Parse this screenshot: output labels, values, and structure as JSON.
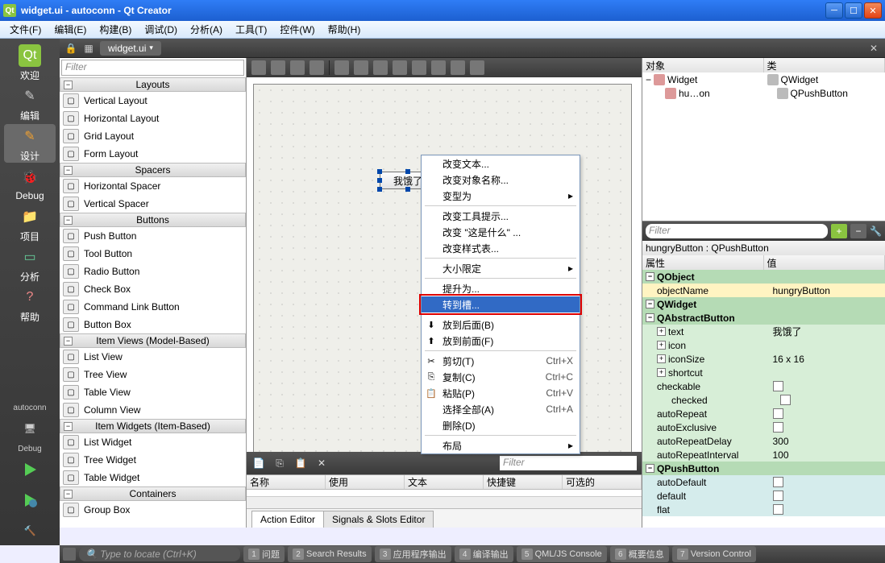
{
  "title": "widget.ui - autoconn - Qt Creator",
  "menu": [
    "文件(F)",
    "编辑(E)",
    "构建(B)",
    "调试(D)",
    "分析(A)",
    "工具(T)",
    "控件(W)",
    "帮助(H)"
  ],
  "leftbar": {
    "items": [
      "欢迎",
      "编辑",
      "设计",
      "Debug",
      "项目",
      "分析",
      "帮助"
    ],
    "project": "autoconn",
    "debug": "Debug"
  },
  "doctab": "widget.ui",
  "wbx": {
    "filter": "Filter",
    "cats": [
      {
        "name": "Layouts",
        "items": [
          "Vertical Layout",
          "Horizontal Layout",
          "Grid Layout",
          "Form Layout"
        ]
      },
      {
        "name": "Spacers",
        "items": [
          "Horizontal Spacer",
          "Vertical Spacer"
        ]
      },
      {
        "name": "Buttons",
        "items": [
          "Push Button",
          "Tool Button",
          "Radio Button",
          "Check Box",
          "Command Link Button",
          "Button Box"
        ]
      },
      {
        "name": "Item Views (Model-Based)",
        "items": [
          "List View",
          "Tree View",
          "Table View",
          "Column View"
        ]
      },
      {
        "name": "Item Widgets (Item-Based)",
        "items": [
          "List Widget",
          "Tree Widget",
          "Table Widget"
        ]
      },
      {
        "name": "Containers",
        "items": [
          "Group Box"
        ]
      }
    ]
  },
  "pushbutton_text": "我饿了",
  "ctx": {
    "items1": [
      "改变文本...",
      "改变对象名称..."
    ],
    "sub1": "变型为",
    "items2": [
      "改变工具提示...",
      "改变 \"这是什么\" ...",
      "改变样式表..."
    ],
    "sub2": "大小限定",
    "items3": [
      "提升为..."
    ],
    "sel": "转到槽...",
    "items4": [
      {
        "l": "放到后面(B)",
        "i": "⬇"
      },
      {
        "l": "放到前面(F)",
        "i": "⬆"
      }
    ],
    "edit": [
      {
        "l": "剪切(T)",
        "s": "Ctrl+X",
        "i": "✂"
      },
      {
        "l": "复制(C)",
        "s": "Ctrl+C",
        "i": "⎘"
      },
      {
        "l": "粘贴(P)",
        "s": "Ctrl+V",
        "i": "📋"
      },
      {
        "l": "选择全部(A)",
        "s": "Ctrl+A"
      },
      {
        "l": "删除(D)"
      }
    ],
    "sub3": "布局"
  },
  "action": {
    "filter": "Filter",
    "cols": [
      "名称",
      "使用",
      "文本",
      "快捷键",
      "可选的"
    ],
    "tabs": [
      "Action Editor",
      "Signals & Slots Editor"
    ]
  },
  "obj": {
    "cols": [
      "对象",
      "类"
    ],
    "rows": [
      {
        "o": "Widget",
        "c": "QWidget"
      },
      {
        "o": "hu…on",
        "c": "QPushButton"
      }
    ]
  },
  "prop": {
    "filter": "Filter",
    "name": "hungryButton : QPushButton",
    "cols": [
      "属性",
      "值"
    ],
    "groups": [
      {
        "g": "QObject",
        "rows": [
          {
            "k": "objectName",
            "v": "hungryButton",
            "c": "yel"
          }
        ]
      },
      {
        "g": "QWidget",
        "rows": []
      },
      {
        "g": "QAbstractButton",
        "rows": [
          {
            "k": "text",
            "v": "我饿了",
            "c": "lg",
            "exp": "+"
          },
          {
            "k": "icon",
            "v": "",
            "c": "lg",
            "exp": "+"
          },
          {
            "k": "iconSize",
            "v": "16 x 16",
            "c": "lg",
            "exp": "+"
          },
          {
            "k": "shortcut",
            "v": "",
            "c": "lg",
            "exp": "+"
          },
          {
            "k": "checkable",
            "v": "",
            "c": "lg",
            "chk": true
          },
          {
            "k": "checked",
            "v": "",
            "c": "lg",
            "chk": true,
            "indent": true
          },
          {
            "k": "autoRepeat",
            "v": "",
            "c": "lg",
            "chk": true
          },
          {
            "k": "autoExclusive",
            "v": "",
            "c": "lg",
            "chk": true
          },
          {
            "k": "autoRepeatDelay",
            "v": "300",
            "c": "lg"
          },
          {
            "k": "autoRepeatInterval",
            "v": "100",
            "c": "lg"
          }
        ]
      },
      {
        "g": "QPushButton",
        "rows": [
          {
            "k": "autoDefault",
            "v": "",
            "c": "lt",
            "chk": true
          },
          {
            "k": "default",
            "v": "",
            "c": "lt",
            "chk": true
          },
          {
            "k": "flat",
            "v": "",
            "c": "lt",
            "chk": true
          }
        ]
      }
    ]
  },
  "status": {
    "locate": "Type to locate (Ctrl+K)",
    "items": [
      "问题",
      "Search Results",
      "应用程序输出",
      "编译输出",
      "QML/JS Console",
      "概要信息",
      "Version Control"
    ]
  }
}
